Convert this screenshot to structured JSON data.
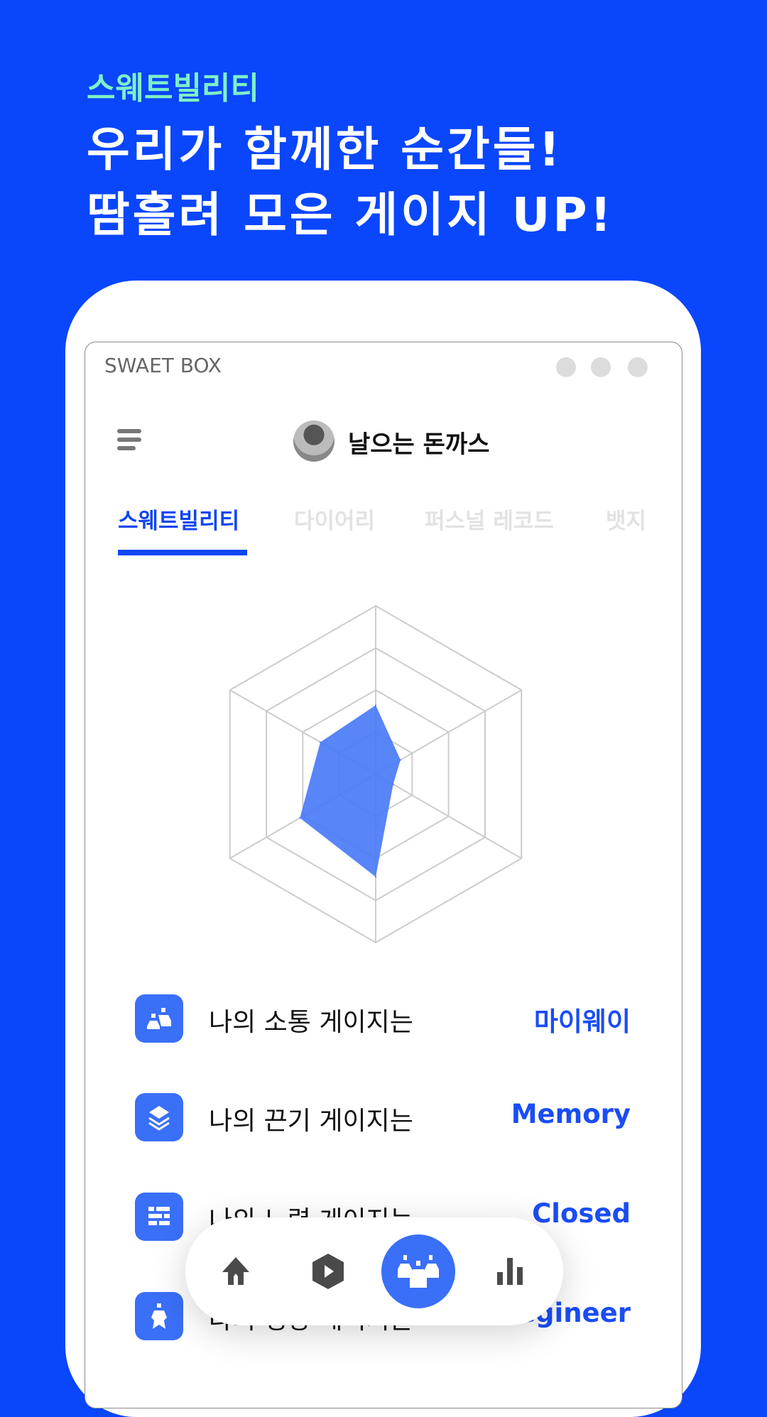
{
  "promo": {
    "subtitle": "스웨트빌리티",
    "headline_line1": "우리가 함께한 순간들!",
    "headline_line2": "땀흘려 모은 게이지 UP!"
  },
  "window": {
    "title": "SWAET BOX"
  },
  "header": {
    "username": "날으는 돈까스",
    "menu_icon": "hamburger-icon"
  },
  "tabs": [
    {
      "label": "스웨트빌리티",
      "active": true
    },
    {
      "label": "다이어리",
      "active": false
    },
    {
      "label": "퍼스널 레코드",
      "active": false
    },
    {
      "label": "뱃지",
      "active": false
    }
  ],
  "chart_data": {
    "type": "radar",
    "axes_count": 6,
    "rings": 4,
    "range": [
      0,
      100
    ],
    "values": [
      41,
      17,
      12,
      61,
      52,
      38
    ],
    "fill_color": "#4a7bf7",
    "grid_color": "#cccccc"
  },
  "gauges": [
    {
      "label": "나의 소통 게이지는",
      "value": "마이웨이",
      "icon": "people-icon"
    },
    {
      "label": "나의 끈기 게이지는",
      "value": "Memory",
      "icon": "layers-icon"
    },
    {
      "label": "나의 노력 게이지는",
      "value": "Closed",
      "icon": "bricks-icon"
    },
    {
      "label": "나의 성장 게이지는",
      "value": "Begineer",
      "icon": "person-icon"
    }
  ],
  "bottom_nav": [
    {
      "icon": "home-icon",
      "active": false
    },
    {
      "icon": "play-hexagon-icon",
      "active": false
    },
    {
      "icon": "community-icon",
      "active": true
    },
    {
      "icon": "bar-chart-icon",
      "active": false
    }
  ],
  "colors": {
    "background": "#0a46fb",
    "accent": "#1146f2",
    "subtitle": "#7ff0c6"
  }
}
